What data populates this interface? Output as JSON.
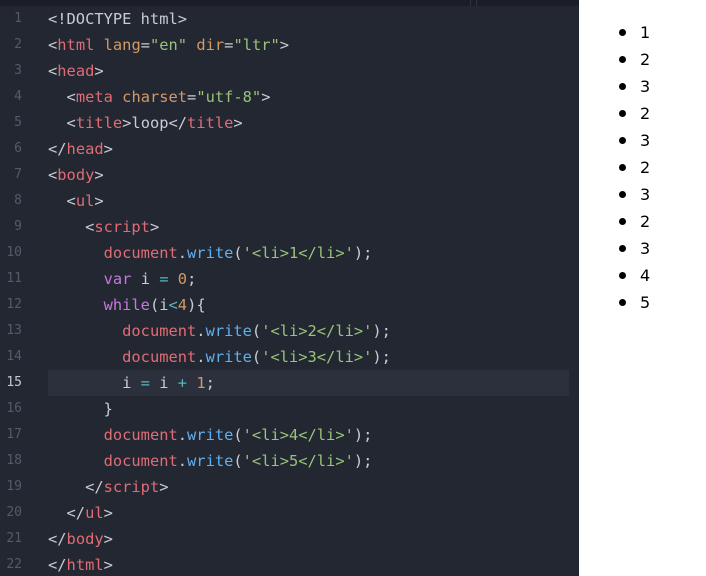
{
  "editor": {
    "line_numbers": [
      "1",
      "2",
      "3",
      "4",
      "5",
      "6",
      "7",
      "8",
      "9",
      "10",
      "11",
      "12",
      "13",
      "14",
      "15",
      "16",
      "17",
      "18",
      "19",
      "20",
      "21",
      "22"
    ],
    "active_line": 15,
    "lines": [
      [
        {
          "t": "<!DOCTYPE html>",
          "c": "punct"
        }
      ],
      [
        {
          "t": "<",
          "c": "punct"
        },
        {
          "t": "html",
          "c": "tag"
        },
        {
          "t": " ",
          "c": "plain"
        },
        {
          "t": "lang",
          "c": "attr"
        },
        {
          "t": "=",
          "c": "punct"
        },
        {
          "t": "\"en\"",
          "c": "string"
        },
        {
          "t": " ",
          "c": "plain"
        },
        {
          "t": "dir",
          "c": "attr"
        },
        {
          "t": "=",
          "c": "punct"
        },
        {
          "t": "\"ltr\"",
          "c": "string"
        },
        {
          "t": ">",
          "c": "punct"
        }
      ],
      [
        {
          "t": "<",
          "c": "punct"
        },
        {
          "t": "head",
          "c": "tag"
        },
        {
          "t": ">",
          "c": "punct"
        }
      ],
      [
        {
          "t": "  <",
          "c": "punct"
        },
        {
          "t": "meta",
          "c": "tag"
        },
        {
          "t": " ",
          "c": "plain"
        },
        {
          "t": "charset",
          "c": "attr"
        },
        {
          "t": "=",
          "c": "punct"
        },
        {
          "t": "\"utf-8\"",
          "c": "string"
        },
        {
          "t": ">",
          "c": "punct"
        }
      ],
      [
        {
          "t": "  <",
          "c": "punct"
        },
        {
          "t": "title",
          "c": "tag"
        },
        {
          "t": ">loop</",
          "c": "punct"
        },
        {
          "t": "title",
          "c": "tag"
        },
        {
          "t": ">",
          "c": "punct"
        }
      ],
      [
        {
          "t": "</",
          "c": "punct"
        },
        {
          "t": "head",
          "c": "tag"
        },
        {
          "t": ">",
          "c": "punct"
        }
      ],
      [
        {
          "t": "<",
          "c": "punct"
        },
        {
          "t": "body",
          "c": "tag"
        },
        {
          "t": ">",
          "c": "punct"
        }
      ],
      [
        {
          "t": "  <",
          "c": "punct"
        },
        {
          "t": "ul",
          "c": "tag"
        },
        {
          "t": ">",
          "c": "punct"
        }
      ],
      [
        {
          "t": "    <",
          "c": "punct"
        },
        {
          "t": "script",
          "c": "tag"
        },
        {
          "t": ">",
          "c": "punct"
        }
      ],
      [
        {
          "t": "      ",
          "c": "plain"
        },
        {
          "t": "document",
          "c": "obj"
        },
        {
          "t": ".",
          "c": "punct"
        },
        {
          "t": "write",
          "c": "method"
        },
        {
          "t": "(",
          "c": "punct"
        },
        {
          "t": "'<li>1</li>'",
          "c": "string"
        },
        {
          "t": ");",
          "c": "punct"
        }
      ],
      [
        {
          "t": "      ",
          "c": "plain"
        },
        {
          "t": "var",
          "c": "keyword"
        },
        {
          "t": " i ",
          "c": "plain"
        },
        {
          "t": "=",
          "c": "op"
        },
        {
          "t": " ",
          "c": "plain"
        },
        {
          "t": "0",
          "c": "num"
        },
        {
          "t": ";",
          "c": "punct"
        }
      ],
      [
        {
          "t": "      ",
          "c": "plain"
        },
        {
          "t": "while",
          "c": "keyword"
        },
        {
          "t": "(i",
          "c": "plain"
        },
        {
          "t": "<",
          "c": "op"
        },
        {
          "t": "4",
          "c": "num"
        },
        {
          "t": "){",
          "c": "punct"
        }
      ],
      [
        {
          "t": "        ",
          "c": "plain"
        },
        {
          "t": "document",
          "c": "obj"
        },
        {
          "t": ".",
          "c": "punct"
        },
        {
          "t": "write",
          "c": "method"
        },
        {
          "t": "(",
          "c": "punct"
        },
        {
          "t": "'<li>2</li>'",
          "c": "string"
        },
        {
          "t": ");",
          "c": "punct"
        }
      ],
      [
        {
          "t": "        ",
          "c": "plain"
        },
        {
          "t": "document",
          "c": "obj"
        },
        {
          "t": ".",
          "c": "punct"
        },
        {
          "t": "write",
          "c": "method"
        },
        {
          "t": "(",
          "c": "punct"
        },
        {
          "t": "'<li>3</li>'",
          "c": "string"
        },
        {
          "t": ");",
          "c": "punct"
        }
      ],
      [
        {
          "t": "        i ",
          "c": "plain"
        },
        {
          "t": "=",
          "c": "op"
        },
        {
          "t": " i ",
          "c": "plain"
        },
        {
          "t": "+",
          "c": "op"
        },
        {
          "t": " ",
          "c": "plain"
        },
        {
          "t": "1",
          "c": "num"
        },
        {
          "t": ";",
          "c": "punct"
        }
      ],
      [
        {
          "t": "      }",
          "c": "punct"
        }
      ],
      [
        {
          "t": "      ",
          "c": "plain"
        },
        {
          "t": "document",
          "c": "obj"
        },
        {
          "t": ".",
          "c": "punct"
        },
        {
          "t": "write",
          "c": "method"
        },
        {
          "t": "(",
          "c": "punct"
        },
        {
          "t": "'<li>4</li>'",
          "c": "string"
        },
        {
          "t": ");",
          "c": "punct"
        }
      ],
      [
        {
          "t": "      ",
          "c": "plain"
        },
        {
          "t": "document",
          "c": "obj"
        },
        {
          "t": ".",
          "c": "punct"
        },
        {
          "t": "write",
          "c": "method"
        },
        {
          "t": "(",
          "c": "punct"
        },
        {
          "t": "'<li>5</li>'",
          "c": "string"
        },
        {
          "t": ");",
          "c": "punct"
        }
      ],
      [
        {
          "t": "    </",
          "c": "punct"
        },
        {
          "t": "script",
          "c": "tag"
        },
        {
          "t": ">",
          "c": "punct"
        }
      ],
      [
        {
          "t": "  </",
          "c": "punct"
        },
        {
          "t": "ul",
          "c": "tag"
        },
        {
          "t": ">",
          "c": "punct"
        }
      ],
      [
        {
          "t": "</",
          "c": "punct"
        },
        {
          "t": "body",
          "c": "tag"
        },
        {
          "t": ">",
          "c": "punct"
        }
      ],
      [
        {
          "t": "</",
          "c": "punct"
        },
        {
          "t": "html",
          "c": "tag"
        },
        {
          "t": ">",
          "c": "punct"
        }
      ]
    ]
  },
  "preview": {
    "items": [
      "1",
      "2",
      "3",
      "2",
      "3",
      "2",
      "3",
      "2",
      "3",
      "4",
      "5"
    ]
  },
  "colors": {
    "editor_bg": "#232732",
    "tag": "#e06c75",
    "attr": "#d19a66",
    "string": "#98c379",
    "method": "#61afef",
    "keyword": "#c678dd"
  }
}
